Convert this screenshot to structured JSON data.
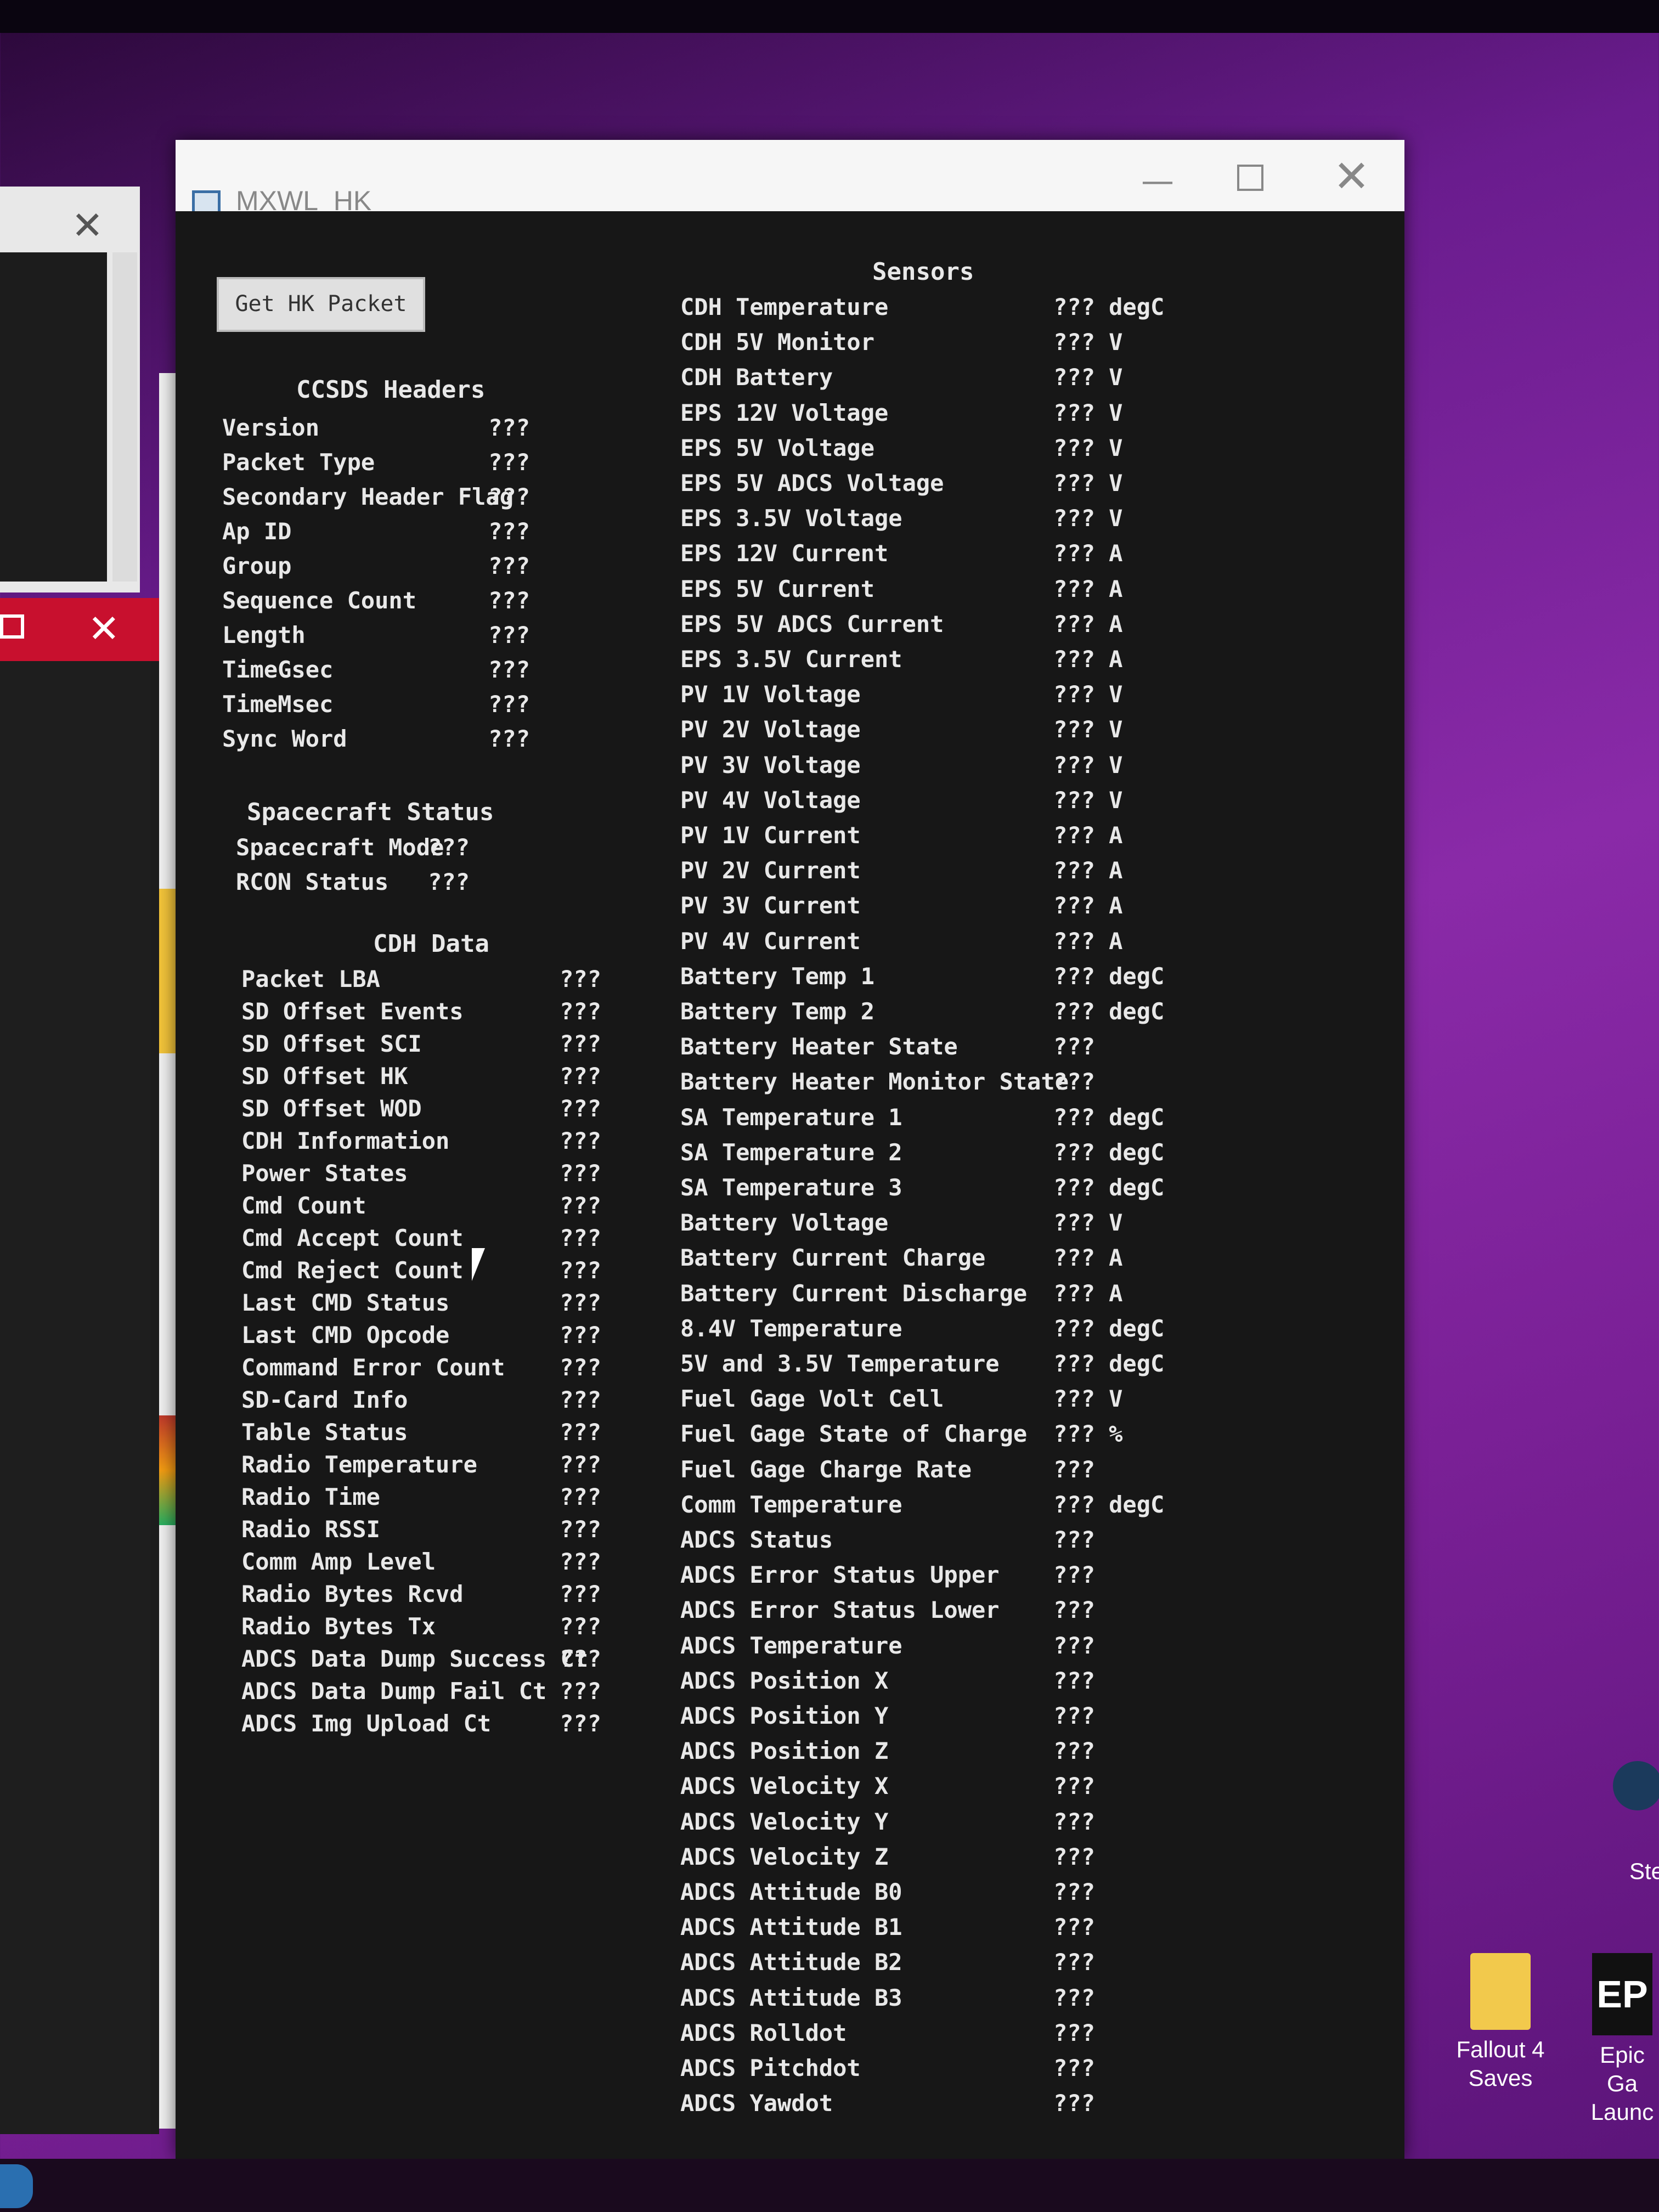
{
  "window": {
    "title": "MXWL_HK",
    "minimize_icon": "minimize-icon",
    "maximize_icon": "maximize-icon",
    "close_icon": "close-icon"
  },
  "button": {
    "label": "Get HK Packet"
  },
  "ccsds": {
    "title": "CCSDS Headers",
    "rows": [
      {
        "label": "Version",
        "value": "???"
      },
      {
        "label": "Packet Type",
        "value": "???"
      },
      {
        "label": "Secondary Header Flag",
        "value": "???"
      },
      {
        "label": "Ap ID",
        "value": "???"
      },
      {
        "label": "Group",
        "value": "???"
      },
      {
        "label": "Sequence Count",
        "value": "???"
      },
      {
        "label": "Length",
        "value": "???"
      },
      {
        "label": "TimeGsec",
        "value": "???"
      },
      {
        "label": "TimeMsec",
        "value": "???"
      },
      {
        "label": "Sync Word",
        "value": "???"
      }
    ]
  },
  "spacecraft": {
    "title": "Spacecraft Status",
    "rows": [
      {
        "label": "Spacecraft Mode",
        "value": "???"
      },
      {
        "label": "RCON Status",
        "value": "???"
      }
    ]
  },
  "cdh": {
    "title": "CDH Data",
    "rows": [
      {
        "label": "Packet LBA",
        "value": "???"
      },
      {
        "label": "SD Offset Events",
        "value": "???"
      },
      {
        "label": "SD Offset SCI",
        "value": "???"
      },
      {
        "label": "SD Offset HK",
        "value": "???"
      },
      {
        "label": "SD Offset WOD",
        "value": "???"
      },
      {
        "label": "CDH Information",
        "value": "???"
      },
      {
        "label": "Power States",
        "value": "???"
      },
      {
        "label": "Cmd Count",
        "value": "???"
      },
      {
        "label": "Cmd Accept Count",
        "value": "???"
      },
      {
        "label": "Cmd Reject Count",
        "value": "???"
      },
      {
        "label": "Last CMD Status",
        "value": "???"
      },
      {
        "label": "Last CMD Opcode",
        "value": "???"
      },
      {
        "label": "Command Error Count",
        "value": "???"
      },
      {
        "label": "SD-Card Info",
        "value": "???"
      },
      {
        "label": "Table Status",
        "value": "???"
      },
      {
        "label": "Radio Temperature",
        "value": "???"
      },
      {
        "label": "Radio Time",
        "value": "???"
      },
      {
        "label": "Radio RSSI",
        "value": "???"
      },
      {
        "label": "Comm Amp Level",
        "value": "???"
      },
      {
        "label": "Radio Bytes Rcvd",
        "value": "???"
      },
      {
        "label": "Radio Bytes Tx",
        "value": "???"
      },
      {
        "label": "ADCS Data Dump Success Ct",
        "value": "???"
      },
      {
        "label": "ADCS Data Dump Fail Ct",
        "value": "???"
      },
      {
        "label": "ADCS Img Upload Ct",
        "value": "???"
      }
    ]
  },
  "sensors": {
    "title": "Sensors",
    "rows": [
      {
        "label": "CDH Temperature",
        "value": "??? degC"
      },
      {
        "label": "CDH 5V Monitor",
        "value": "??? V"
      },
      {
        "label": "CDH Battery",
        "value": "??? V"
      },
      {
        "label": "EPS 12V Voltage",
        "value": "??? V"
      },
      {
        "label": "EPS 5V Voltage",
        "value": "??? V"
      },
      {
        "label": "EPS 5V ADCS Voltage",
        "value": "??? V"
      },
      {
        "label": "EPS 3.5V Voltage",
        "value": "??? V"
      },
      {
        "label": "EPS 12V Current",
        "value": "??? A"
      },
      {
        "label": "EPS 5V Current",
        "value": "??? A"
      },
      {
        "label": "EPS 5V ADCS Current",
        "value": "??? A"
      },
      {
        "label": "EPS 3.5V Current",
        "value": "??? A"
      },
      {
        "label": "PV 1V Voltage",
        "value": "??? V"
      },
      {
        "label": "PV 2V Voltage",
        "value": "??? V"
      },
      {
        "label": "PV 3V Voltage",
        "value": "??? V"
      },
      {
        "label": "PV 4V Voltage",
        "value": "??? V"
      },
      {
        "label": "PV 1V Current",
        "value": "??? A"
      },
      {
        "label": "PV 2V Current",
        "value": "??? A"
      },
      {
        "label": "PV 3V Current",
        "value": "??? A"
      },
      {
        "label": "PV 4V Current",
        "value": "??? A"
      },
      {
        "label": "Battery Temp 1",
        "value": "??? degC"
      },
      {
        "label": "Battery Temp 2",
        "value": "??? degC"
      },
      {
        "label": "Battery Heater State",
        "value": "???"
      },
      {
        "label": "Battery Heater Monitor State",
        "value": "???"
      },
      {
        "label": "SA Temperature 1",
        "value": "??? degC"
      },
      {
        "label": "SA Temperature 2",
        "value": "??? degC"
      },
      {
        "label": "SA Temperature 3",
        "value": "??? degC"
      },
      {
        "label": "Battery Voltage",
        "value": "??? V"
      },
      {
        "label": "Battery Current Charge",
        "value": "??? A"
      },
      {
        "label": "Battery Current Discharge",
        "value": "??? A"
      },
      {
        "label": "8.4V Temperature",
        "value": "??? degC"
      },
      {
        "label": "5V and 3.5V Temperature",
        "value": "??? degC"
      },
      {
        "label": "Fuel Gage Volt Cell",
        "value": "??? V"
      },
      {
        "label": "Fuel Gage State of Charge",
        "value": "??? %"
      },
      {
        "label": "Fuel Gage Charge Rate",
        "value": "???"
      },
      {
        "label": "Comm Temperature",
        "value": "??? degC"
      },
      {
        "label": "ADCS Status",
        "value": "???"
      },
      {
        "label": "ADCS Error Status Upper",
        "value": "???"
      },
      {
        "label": "ADCS Error Status Lower",
        "value": "???"
      },
      {
        "label": "ADCS Temperature",
        "value": "???"
      },
      {
        "label": "ADCS Position X",
        "value": "???"
      },
      {
        "label": "ADCS Position Y",
        "value": "???"
      },
      {
        "label": "ADCS Position Z",
        "value": "???"
      },
      {
        "label": "ADCS Velocity X",
        "value": "???"
      },
      {
        "label": "ADCS Velocity Y",
        "value": "???"
      },
      {
        "label": "ADCS Velocity Z",
        "value": "???"
      },
      {
        "label": "ADCS Attitude B0",
        "value": "???"
      },
      {
        "label": "ADCS Attitude B1",
        "value": "???"
      },
      {
        "label": "ADCS Attitude B2",
        "value": "???"
      },
      {
        "label": "ADCS Attitude B3",
        "value": "???"
      },
      {
        "label": "ADCS Rolldot",
        "value": "???"
      },
      {
        "label": "ADCS Pitchdot",
        "value": "???"
      },
      {
        "label": "ADCS Yawdot",
        "value": "???"
      }
    ]
  },
  "desktop": {
    "icons": [
      {
        "label1": "Fallout 4",
        "label2": "Saves",
        "icon": "folder-icon"
      },
      {
        "label1": "Epic Ga",
        "label2": "Launc",
        "icon": "epic-games-icon"
      }
    ],
    "steam_label": "Ste",
    "epic_glyph": "EP"
  }
}
